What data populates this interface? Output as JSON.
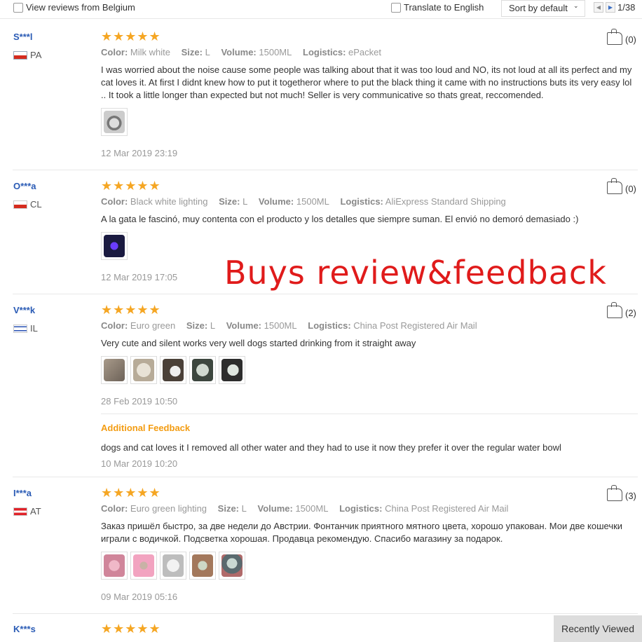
{
  "topbar": {
    "belgium_label": "View reviews from Belgium",
    "translate_label": "Translate to English",
    "sort_label": "Sort by default",
    "page_indicator": "1/38",
    "prev_glyph": "◀",
    "next_glyph": "▶"
  },
  "watermark": "Buys review&feedback",
  "recently_viewed": "Recently Viewed",
  "reviews": [
    {
      "user": "S***l",
      "country": "PA",
      "stars": "★★★★★",
      "color_label": "Color:",
      "color": "Milk white",
      "size_label": "Size:",
      "size": "L",
      "volume_label": "Volume:",
      "volume": "1500ML",
      "logistics_label": "Logistics:",
      "logistics": "ePacket",
      "text": "I was worried about the noise cause some people was talking about that it was too loud and NO, its not loud at all its perfect and my cat loves it. At first I didnt knew how to put it togetheror where to put the black thing it came with no instructions buts its very easy lol .. It took a little longer than expected but not much! Seller is very communicative so thats great, reccomended.",
      "date": "12 Mar 2019 23:19",
      "likes": "(0)"
    },
    {
      "user": "O***a",
      "country": "CL",
      "stars": "★★★★★",
      "color_label": "Color:",
      "color": "Black white lighting",
      "size_label": "Size:",
      "size": "L",
      "volume_label": "Volume:",
      "volume": "1500ML",
      "logistics_label": "Logistics:",
      "logistics": "AliExpress Standard Shipping",
      "text": "A la gata le fascinó, muy contenta con el producto y los detalles que siempre suman. El envió no demoró demasiado :)",
      "date": "12 Mar 2019 17:05",
      "likes": "(0)"
    },
    {
      "user": "V***k",
      "country": "IL",
      "stars": "★★★★★",
      "color_label": "Color:",
      "color": "Euro green",
      "size_label": "Size:",
      "size": "L",
      "volume_label": "Volume:",
      "volume": "1500ML",
      "logistics_label": "Logistics:",
      "logistics": "China Post Registered Air Mail",
      "text": "Very cute and silent works very well dogs started drinking from it straight away",
      "date": "28 Feb 2019 10:50",
      "likes": "(2)",
      "additional_label": "Additional Feedback",
      "additional_text": "dogs and cat loves it I removed all other water and they had to use it now they prefer it over the regular water bowl",
      "additional_date": "10 Mar 2019 10:20"
    },
    {
      "user": "I***a",
      "country": "AT",
      "stars": "★★★★★",
      "color_label": "Color:",
      "color": "Euro green lighting",
      "size_label": "Size:",
      "size": "L",
      "volume_label": "Volume:",
      "volume": "1500ML",
      "logistics_label": "Logistics:",
      "logistics": "China Post Registered Air Mail",
      "text": "Заказ пришёл быстро, за две недели до Австрии. Фонтанчик приятного мятного цвета, хорошо упакован. Мои две кошечки играли с водичкой. Подсветка хорошая. Продавца рекомендую. Спасибо магазину за подарок.",
      "date": "09 Mar 2019 05:16",
      "likes": "(3)"
    },
    {
      "user": "K***s",
      "stars": "★★★★★"
    }
  ]
}
